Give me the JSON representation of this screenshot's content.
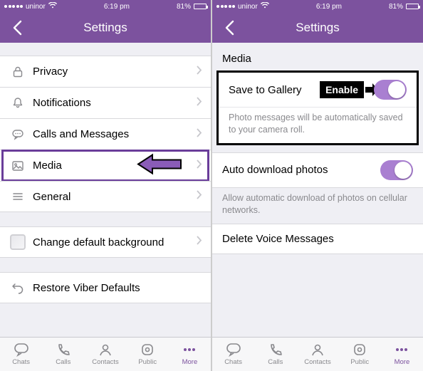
{
  "status": {
    "carrier": "uninor",
    "wifi": true,
    "time": "6:19 pm",
    "battery_pct": "81%"
  },
  "nav": {
    "title": "Settings"
  },
  "left": {
    "rows": [
      {
        "id": "privacy",
        "label": "Privacy"
      },
      {
        "id": "notifications",
        "label": "Notifications"
      },
      {
        "id": "calls",
        "label": "Calls and Messages"
      },
      {
        "id": "media",
        "label": "Media"
      },
      {
        "id": "general",
        "label": "General"
      }
    ],
    "change_bg": "Change default background",
    "restore": "Restore Viber Defaults",
    "highlight": "media"
  },
  "right": {
    "section": "Media",
    "save_gallery": {
      "label": "Save to Gallery",
      "desc": "Photo messages will be automatically saved to your camera roll.",
      "on": true,
      "annotation": "Enable"
    },
    "auto_dl": {
      "label": "Auto download photos",
      "desc": "Allow automatic download of photos on cellular networks.",
      "on": true
    },
    "delete_voice": "Delete Voice Messages"
  },
  "tabs": [
    {
      "id": "chats",
      "label": "Chats"
    },
    {
      "id": "calls",
      "label": "Calls"
    },
    {
      "id": "contacts",
      "label": "Contacts"
    },
    {
      "id": "public",
      "label": "Public"
    },
    {
      "id": "more",
      "label": "More"
    }
  ],
  "active_tab": "more"
}
